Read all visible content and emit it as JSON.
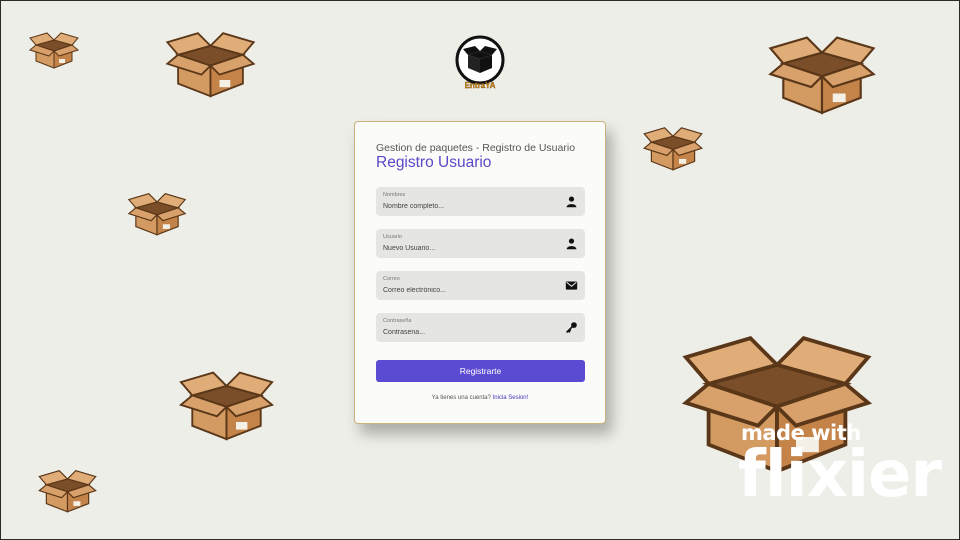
{
  "logo": {
    "text": "EntraYA"
  },
  "card": {
    "subtitle": "Gestion de paquetes - Registro de Usuario",
    "title": "Registro Usuario"
  },
  "fields": [
    {
      "label": "Nombres",
      "placeholder": "Nombre completo...",
      "icon": "person-icon"
    },
    {
      "label": "Usuario",
      "placeholder": "Nuevo Usuario...",
      "icon": "person-icon"
    },
    {
      "label": "Correo",
      "placeholder": "Correo electrónico...",
      "icon": "envelope-icon"
    },
    {
      "label": "Contraseña",
      "placeholder": "Contrasena...",
      "icon": "key-icon"
    }
  ],
  "submit_label": "Registrarte",
  "footer": {
    "question": "Ya tienes una cuenta?",
    "link": "Inicia Sesion!"
  },
  "watermark": {
    "line1": "made with",
    "line2": "flixier"
  },
  "colors": {
    "accent": "#5b4ad2",
    "background": "#eeeee8",
    "box": "#c98e55"
  }
}
